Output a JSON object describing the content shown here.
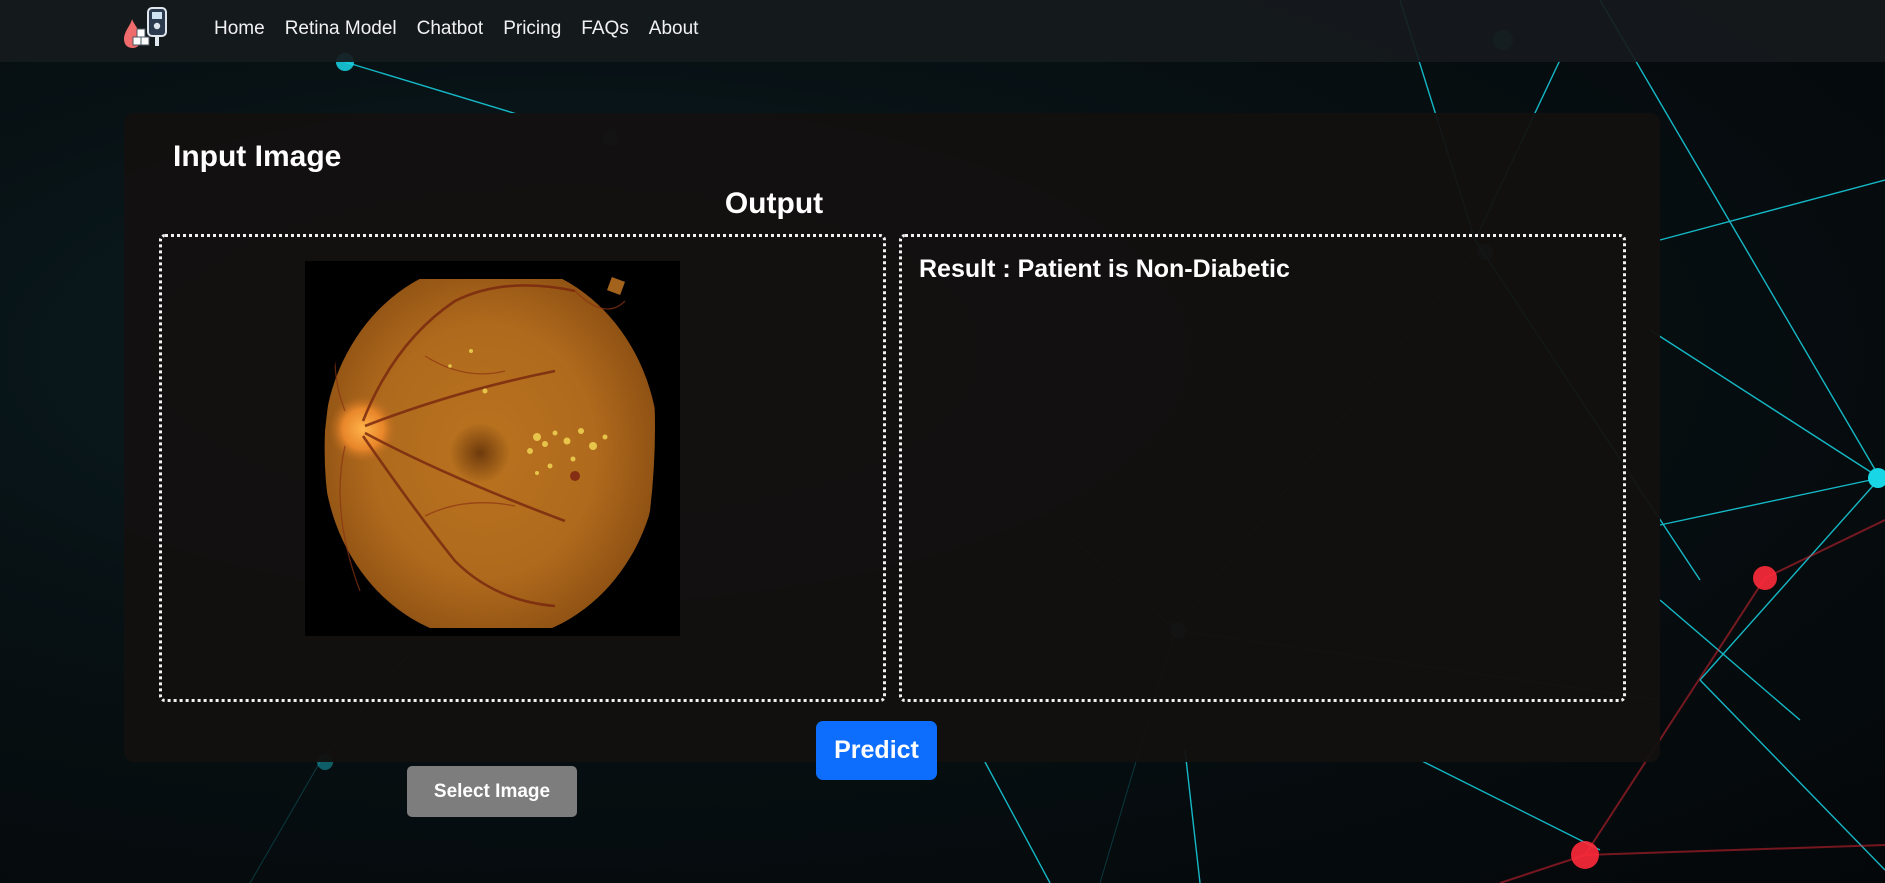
{
  "nav": {
    "logo_icon": "diabetes-glucose-meter-icon",
    "links": [
      "Home",
      "Retina Model",
      "Chatbot",
      "Pricing",
      "FAQs",
      "About"
    ]
  },
  "main": {
    "input_title": "Input Image",
    "output_title": "Output",
    "input_image_icon": "retina-fundus-image",
    "select_button": "Select Image",
    "result_text": "Result : Patient is Non-Diabetic",
    "predict_button": "Predict"
  },
  "colors": {
    "predict_button": "#0d6efd",
    "select_button": "#7d7d7d",
    "network_line": "#18d6e6",
    "network_node_red": "#ff2a3a"
  }
}
